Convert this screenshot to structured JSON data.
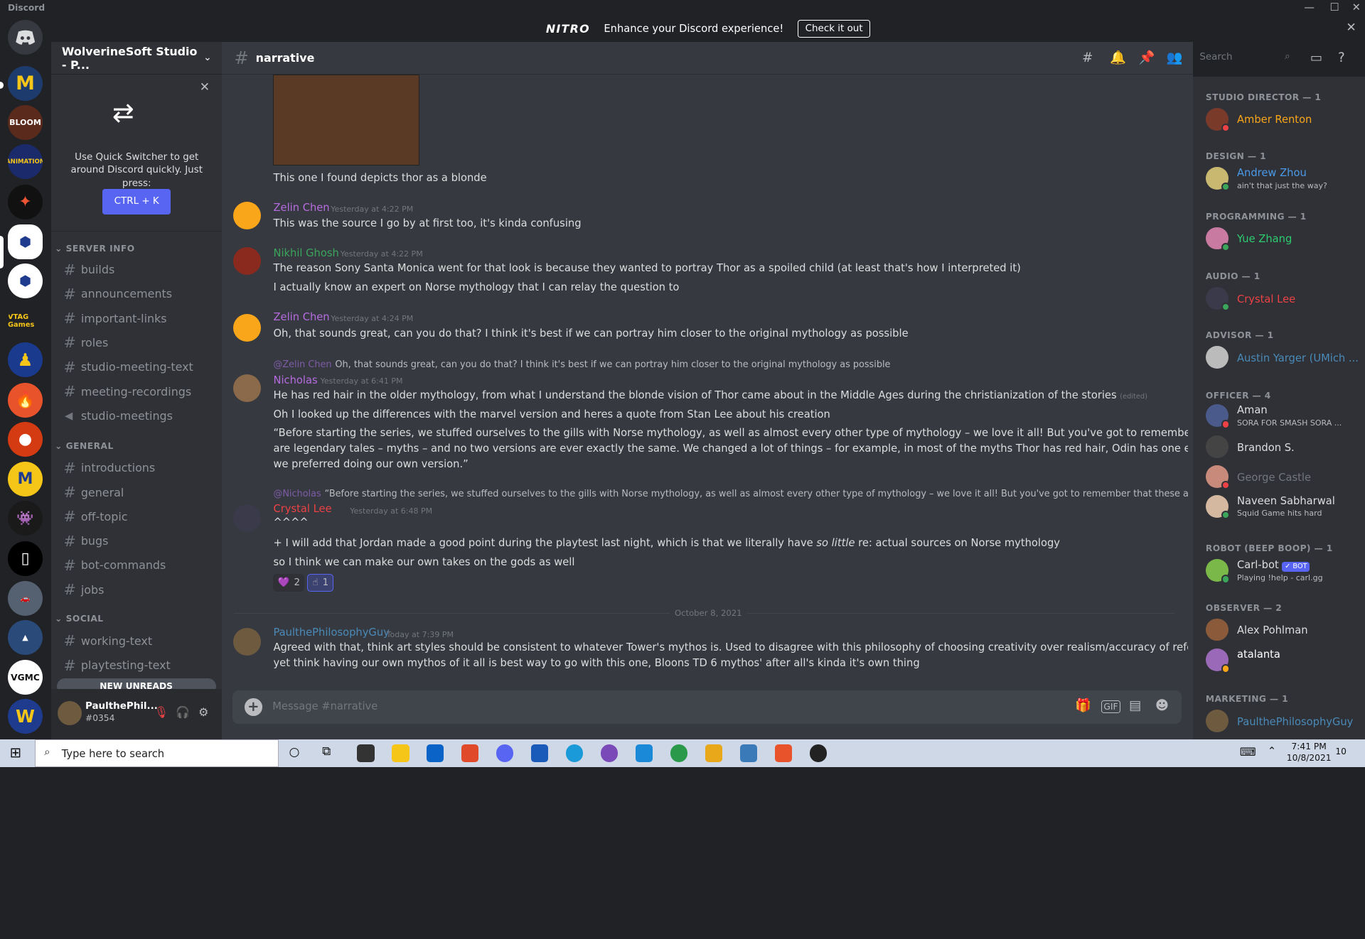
{
  "window": {
    "app_title": "Discord",
    "minimize": "—",
    "maximize": "☐",
    "close": "✕"
  },
  "nitro": {
    "logo": "NITRO",
    "text": "Enhance your Discord experience!",
    "button": "Check it out",
    "close": "✕"
  },
  "server": {
    "name": "WolverineSoft Studio - P...",
    "chevron": "⌄"
  },
  "quick_switcher": {
    "close": "✕",
    "description": "Use Quick Switcher to get around Discord quickly. Just press:",
    "shortcut": "CTRL + K",
    "icon": "⇄"
  },
  "categories": {
    "server_info": "SERVER INFO",
    "general": "GENERAL",
    "social": "SOCIAL"
  },
  "channels": {
    "server_info": [
      "builds",
      "announcements",
      "important-links",
      "roles",
      "studio-meeting-text",
      "meeting-recordings",
      "studio-meetings"
    ],
    "general": [
      "introductions",
      "general",
      "off-topic",
      "bugs",
      "bot-commands",
      "jobs"
    ],
    "social": [
      "working-text",
      "playtesting-text"
    ]
  },
  "new_unreads": "NEW UNREADS",
  "user_panel": {
    "name": "PaulthePhil...",
    "tag": "#0354"
  },
  "channel": {
    "name": "narrative"
  },
  "search": {
    "placeholder": "Search"
  },
  "messages": {
    "m0": {
      "text": "This one I found depicts thor as a blonde"
    },
    "m1": {
      "author": "Zelin Chen",
      "time": "Yesterday at 4:22 PM",
      "text": "This was the source I go by at first too, it's kinda confusing"
    },
    "m2": {
      "author": "Nikhil Ghosh",
      "time": "Yesterday at 4:22 PM",
      "line1": "The reason Sony Santa Monica went for that look is because they wanted to portray Thor as a spoiled child (at least that's how I interpreted it)",
      "line2": "I actually know an expert on Norse mythology that I can relay the question to"
    },
    "m3": {
      "author": "Zelin Chen",
      "time": "Yesterday at 4:24 PM",
      "text": "Oh, that sounds great, can you do that? I think it's best if we can portray him closer to the original mythology as possible"
    },
    "m4": {
      "reply_name": "@Zelin Chen",
      "reply_text": "Oh, that sounds great, can you do that? I think it's best if we can portray him closer to the original mythology as possible",
      "author": "Nicholas",
      "time": "Yesterday at 6:41 PM",
      "line1": "He has red hair in the older mythology, from what I understand the blonde vision of Thor came about in the Middle Ages during the christianization of the stories",
      "edited": "(edited)",
      "line2": "Oh I looked up the differences with the marvel version and heres a quote from Stan Lee about his creation",
      "quote1": "“Before starting the series, we stuffed ourselves to the gills with Norse mythology, as well as almost every other type of mythology – we love it all! But you've got to remember that these",
      "quote2": "are legendary tales – myths – and no two versions are ever exactly the same. We changed a lot of things – for example, in most of the myths Thor has red hair, Odin has one eye, etc. But",
      "quote3": "we preferred doing our own version.”"
    },
    "m5": {
      "reply_name": "@Nicholas",
      "reply_text": "“Before starting the series, we stuffed ourselves to the gills with Norse mythology, as well as almost every other type of mythology – we love it all! But you've got to remember that these are legend...",
      "author": "Crystal Lee",
      "time": "Yesterday at 6:48 PM",
      "line0": "^^^^",
      "line1a": "+ I will add that Jordan made a good point during the playtest last night, which is that we literally have ",
      "line1b": "so little",
      "line1c": " re: actual sources on Norse mythology",
      "line2": "so I think we can make our own takes on the gods as well",
      "reactions": [
        {
          "emoji": "💜",
          "count": "2"
        },
        {
          "emoji": "☝",
          "count": "1"
        }
      ]
    },
    "date_divider": "October 8, 2021",
    "m6": {
      "author": "PaulthePhilosophyGuy",
      "time": "Today at 7:39 PM",
      "line1": "Agreed with that, think art styles should be consistent to whatever Tower's mythos is. Used to disagree with this philosophy of choosing creativity over realism/accuracy of references,",
      "line2": "yet think having our own mythos of it all is best way to go with this one, Bloons TD 6 mythos' after all's kinda it's own thing"
    }
  },
  "composer": {
    "placeholder": "Message #narrative",
    "gif": "GIF"
  },
  "members": {
    "roles": [
      "STUDIO DIRECTOR — 1",
      "DESIGN — 1",
      "PROGRAMMING — 1",
      "AUDIO — 1",
      "ADVISOR — 1",
      "OFFICER — 4",
      "ROBOT (BEEP BOOP) — 1",
      "OBSERVER — 2",
      "MARKETING — 1"
    ],
    "list": [
      {
        "name": "Amber Renton",
        "sub": ""
      },
      {
        "name": "Andrew Zhou",
        "sub": "ain't that just the way?"
      },
      {
        "name": "Yue Zhang",
        "sub": ""
      },
      {
        "name": "Crystal Lee",
        "sub": ""
      },
      {
        "name": "Austin Yarger (UMich ...",
        "sub": ""
      },
      {
        "name": "Aman",
        "sub": "SORA FOR SMASH SORA ..."
      },
      {
        "name": "Brandon S.",
        "sub": ""
      },
      {
        "name": "George Castle",
        "sub": ""
      },
      {
        "name": "Naveen Sabharwal",
        "sub": "Squid Game hits hard"
      },
      {
        "name": "Carl-bot",
        "sub": "Playing !help - carl.gg",
        "badge": "✓ BOT"
      },
      {
        "name": "Alex Pohlman",
        "sub": ""
      },
      {
        "name": "atalanta",
        "sub": ""
      },
      {
        "name": "PaulthePhilosophyGuy",
        "sub": ""
      }
    ]
  },
  "taskbar": {
    "search_placeholder": "Type here to search",
    "time": "7:41 PM",
    "date": "10/8/2021",
    "notif_count": "10"
  },
  "colors": {
    "accent": "#5865f2",
    "bg_main": "#36393f",
    "bg_sidebar": "#2f3136",
    "online": "#3ba55c",
    "dnd": "#ed4245"
  }
}
